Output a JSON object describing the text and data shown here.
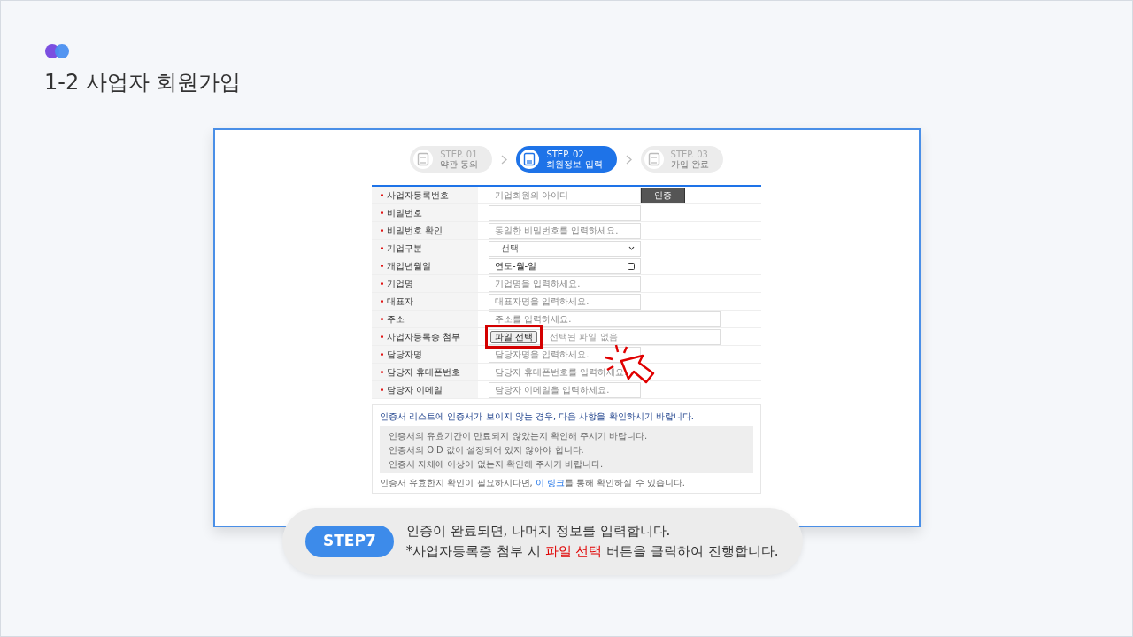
{
  "title": "1-2 사업자 회원가입",
  "steps": [
    {
      "step": "STEP. 01",
      "label": "약관 동의",
      "selected": false
    },
    {
      "step": "STEP. 02",
      "label": "회원정보 입력",
      "selected": true
    },
    {
      "step": "STEP. 03",
      "label": "가입 완료",
      "selected": false
    }
  ],
  "form": {
    "rows": [
      {
        "label": "사업자등록번호",
        "required": true,
        "kind": "text",
        "placeholder": "기업회원의 아이디",
        "wide": false,
        "button": "인증"
      },
      {
        "label": "비밀번호",
        "required": true,
        "kind": "text",
        "wide": false
      },
      {
        "label": "비밀번호 확인",
        "required": true,
        "kind": "text",
        "placeholder": "동일한 비밀번호를 입력하세요.",
        "wide": false
      },
      {
        "label": "기업구분",
        "required": true,
        "kind": "select",
        "value": "--선택--",
        "wide": false
      },
      {
        "label": "개업년월일",
        "required": true,
        "kind": "date",
        "value": "연도-월-일",
        "wide": false
      },
      {
        "label": "기업명",
        "required": true,
        "kind": "text",
        "placeholder": "기업명을 입력하세요.",
        "wide": false
      },
      {
        "label": "대표자",
        "required": true,
        "kind": "text",
        "placeholder": "대표자명을 입력하세요.",
        "wide": false
      },
      {
        "label": "주소",
        "required": true,
        "kind": "text",
        "placeholder": "주소를 입력하세요.",
        "wide": true
      },
      {
        "label": "사업자등록증 첨부",
        "required": true,
        "kind": "file",
        "button": "파일 선택",
        "value": "선택된 파일 없음",
        "wide": true,
        "highlighted": true
      },
      {
        "label": "담당자명",
        "required": true,
        "kind": "text",
        "placeholder": "담당자명을 입력하세요.",
        "wide": false
      },
      {
        "label": "담당자 휴대폰번호",
        "required": true,
        "kind": "text",
        "placeholder": "담당자 휴대폰번호를 입력하세요.",
        "wide": false
      },
      {
        "label": "담당자 이메일",
        "required": true,
        "kind": "text",
        "placeholder": "담당자 이메일을 입력하세요.",
        "wide": false
      }
    ]
  },
  "notice": {
    "title": "인증서 리스트에 인증서가 보이지 않는 경우, 다음 사항을 확인하시기 바랍니다.",
    "items": [
      "인증서의 유효기간이 만료되지 않았는지 확인해 주시기 바랍니다.",
      "인증서의 OID 값이 설정되어 있지 않아야 합니다.",
      "인증서 자체에 이상이 없는지 확인해 주시기 바랍니다."
    ],
    "footer": {
      "before": "인증서 유효한지 확인이 필요하시다면, ",
      "link": "이 링크",
      "after": "를 통해 확인하실 수 있습니다."
    }
  },
  "callout": {
    "badge": "STEP7",
    "line1": "인증이 완료되면, 나머지 정보를 입력합니다.",
    "line2": [
      {
        "text": "*사업자등록증 첨부 시 ",
        "highlight": false
      },
      {
        "text": "파일 선택",
        "highlight": true
      },
      {
        "text": " 버튼을 클릭하여 진행합니다.",
        "highlight": false
      }
    ]
  }
}
